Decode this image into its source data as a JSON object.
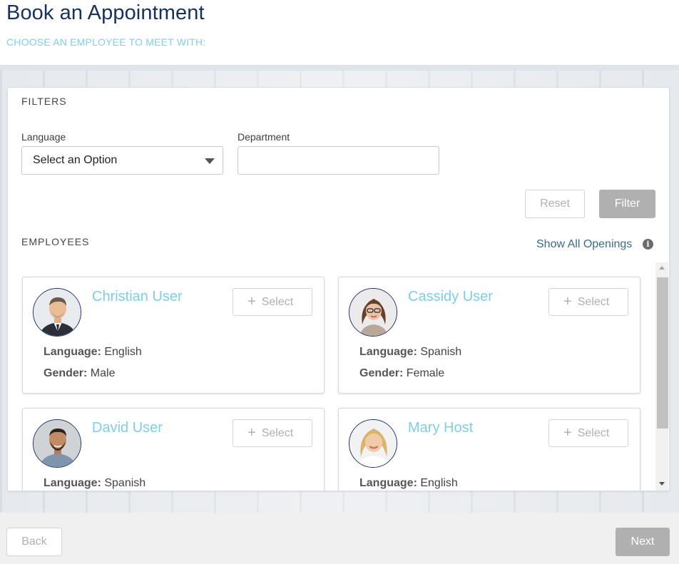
{
  "header": {
    "title": "Book an Appointment",
    "subtitle": "CHOOSE AN EMPLOYEE TO MEET WITH:"
  },
  "filters": {
    "section_title": "FILTERS",
    "language_label": "Language",
    "language_value": "Select an Option",
    "department_label": "Department",
    "department_value": "",
    "reset_label": "Reset",
    "filter_label": "Filter"
  },
  "employees": {
    "section_title": "EMPLOYEES",
    "show_all_label": "Show All Openings",
    "language_key": "Language:",
    "gender_key": "Gender:",
    "select_label": "Select",
    "items": [
      {
        "name": "Christian User",
        "language": "English",
        "gender": "Male"
      },
      {
        "name": "Cassidy User",
        "language": "Spanish",
        "gender": "Female"
      },
      {
        "name": "David User",
        "language": "Spanish"
      },
      {
        "name": "Mary Host",
        "language": "English"
      }
    ]
  },
  "footer": {
    "back_label": "Back",
    "next_label": "Next"
  },
  "colors": {
    "title": "#16325c",
    "subtitle": "#7dd0e8",
    "employee_name": "#7dcfe8",
    "link": "#3a6b8a",
    "disabled_button": "#b0b0b0"
  },
  "icons": [
    "caret-down-icon",
    "info-icon",
    "plus-icon",
    "scroll-up-icon",
    "scroll-down-icon"
  ]
}
